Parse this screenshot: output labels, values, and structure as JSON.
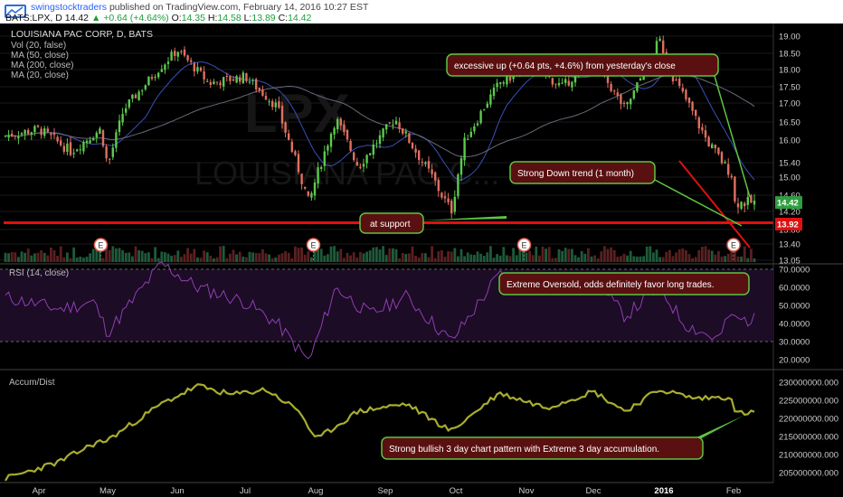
{
  "header": {
    "user": "swingstocktraders",
    "published": "published on TradingView.com, February 14, 2016 10:27 EST",
    "symbol": "BATS:LPX, D",
    "last": "14.42",
    "change": "+0.64 (+4.64%)",
    "o_label": "O:",
    "o": "14.35",
    "h_label": "H:",
    "h": "14.58",
    "l_label": "L:",
    "l": "13.89",
    "c_label": "C:",
    "c": "14.42"
  },
  "legend": {
    "title": "LOUISIANA PAC CORP, D, BATS",
    "lines": [
      "Vol (20, false)",
      "MA (50, close)",
      "MA (200, close)",
      "MA (20, close)"
    ]
  },
  "watermark": {
    "ticker": "LPX",
    "name": "LOUISIANA PAC C..."
  },
  "earnings_marker": "E",
  "rsi_title": "RSI (14, close)",
  "ad_title": "Accum/Dist",
  "annotations": {
    "excessive": "excessive up (+0.64 pts, +4.6%) from yesterday's close",
    "downtrend": "Strong Down trend (1 month)",
    "support": "at support",
    "oversold": "Extreme Oversold, odds definitely favor long trades.",
    "bullish": "Strong bullish 3 day chart pattern with Extreme 3 day accumulation."
  },
  "colors": {
    "up": "#26a69a",
    "up_candle": "#5dc94e",
    "down": "#e07060",
    "support": "#e01010",
    "ma50": "#3b4fb8",
    "ma200": "#6a6a7a",
    "rsi": "#8e3fb0",
    "ad": "#a8ad2e",
    "annotation_bg": "#5a1010",
    "annotation_border": "#5ec440",
    "price_tag_last": "#2e9e3e",
    "price_tag_support": "#e01010"
  },
  "chart_data": [
    {
      "type": "candlestick",
      "title": "LOUISIANA PAC CORP, D, BATS",
      "x_ticks": [
        "Apr",
        "May",
        "Jun",
        "Jul",
        "Aug",
        "Sep",
        "Oct",
        "Nov",
        "Dec",
        "2016",
        "Feb"
      ],
      "y_ticks": [
        "13.05",
        "13.40",
        "13.80",
        "14.20",
        "14.60",
        "15.00",
        "15.40",
        "16.00",
        "16.50",
        "17.00",
        "17.50",
        "18.00",
        "18.50",
        "19.00"
      ],
      "ylim": [
        13.05,
        19.25
      ],
      "price_tags": {
        "last": "14.42",
        "support": "13.92"
      },
      "support_level": 13.95,
      "close_series_keypoints": [
        [
          "Mar 20",
          16.1
        ],
        [
          "Apr 1",
          16.3
        ],
        [
          "Apr 15",
          15.7
        ],
        [
          "Apr 28",
          16.3
        ],
        [
          "May 1",
          15.3
        ],
        [
          "May 8",
          16.8
        ],
        [
          "May 22",
          17.9
        ],
        [
          "Jun 1",
          18.6
        ],
        [
          "Jun 15",
          17.6
        ],
        [
          "Jul 1",
          17.8
        ],
        [
          "Jul 15",
          16.9
        ],
        [
          "Jul 29",
          14.4
        ],
        [
          "Aug 10",
          16.6
        ],
        [
          "Aug 20",
          15.3
        ],
        [
          "Sep 5",
          16.6
        ],
        [
          "Sep 29",
          14.2
        ],
        [
          "Oct 5",
          16.0
        ],
        [
          "Oct 20",
          17.6
        ],
        [
          "Nov 3",
          18.1
        ],
        [
          "Nov 17",
          17.5
        ],
        [
          "Dec 1",
          18.3
        ],
        [
          "Dec 15",
          16.8
        ],
        [
          "Dec 30",
          18.9
        ],
        [
          "Jan 5",
          17.8
        ],
        [
          "Jan 20",
          16.0
        ],
        [
          "Feb 1",
          15.0
        ],
        [
          "Feb 10",
          13.9
        ],
        [
          "Feb 12",
          14.42
        ]
      ]
    },
    {
      "type": "line",
      "title": "RSI (14, close)",
      "y_ticks": [
        "20.0000",
        "30.0000",
        "40.0000",
        "50.0000",
        "60.0000",
        "70.0000"
      ],
      "ylim": [
        16,
        76
      ],
      "bands": [
        30,
        70
      ],
      "series": [
        {
          "values": [
            [
              "Mar 20",
              55
            ],
            [
              "Apr 10",
              48
            ],
            [
              "Apr 25",
              52
            ],
            [
              "May 1",
              35
            ],
            [
              "May 25",
              73
            ],
            [
              "Jun 10",
              60
            ],
            [
              "Jul 1",
              52
            ],
            [
              "Jul 15",
              40
            ],
            [
              "Jul 29",
              19
            ],
            [
              "Aug 10",
              60
            ],
            [
              "Aug 25",
              45
            ],
            [
              "Sep 10",
              55
            ],
            [
              "Sep 29",
              30
            ],
            [
              "Oct 20",
              67
            ],
            [
              "Nov 10",
              60
            ],
            [
              "Dec 1",
              64
            ],
            [
              "Dec 15",
              44
            ],
            [
              "Dec 30",
              60
            ],
            [
              "Jan 10",
              40
            ],
            [
              "Jan 25",
              31
            ],
            [
              "Feb 5",
              48
            ],
            [
              "Feb 10",
              33
            ],
            [
              "Feb 12",
              42
            ]
          ]
        }
      ]
    },
    {
      "type": "line",
      "title": "Accum/Dist",
      "y_ticks": [
        "205000000.000",
        "210000000.000",
        "215000000.000",
        "220000000.000",
        "225000000.000",
        "230000000.000"
      ],
      "ylim": [
        202000000,
        232500000
      ],
      "series": [
        {
          "values": [
            [
              "Mar 20",
              203000000
            ],
            [
              "Apr 10",
              208000000
            ],
            [
              "Apr 25",
              213000000
            ],
            [
              "May 1",
              214000000
            ],
            [
              "May 25",
              224000000
            ],
            [
              "Jun 10",
              229000000
            ],
            [
              "Jun 25",
              226500000
            ],
            [
              "Jul 10",
              228000000
            ],
            [
              "Jul 25",
              222000000
            ],
            [
              "Aug 1",
              214000000
            ],
            [
              "Aug 20",
              222000000
            ],
            [
              "Sep 10",
              224000000
            ],
            [
              "Sep 29",
              216500000
            ],
            [
              "Oct 20",
              227000000
            ],
            [
              "Nov 10",
              223000000
            ],
            [
              "Dec 1",
              227500000
            ],
            [
              "Dec 15",
              222000000
            ],
            [
              "Dec 30",
              228000000
            ],
            [
              "Jan 15",
              225500000
            ],
            [
              "Feb 1",
              226000000
            ],
            [
              "Feb 8",
              219000000
            ],
            [
              "Feb 12",
              221500000
            ]
          ]
        }
      ]
    }
  ]
}
